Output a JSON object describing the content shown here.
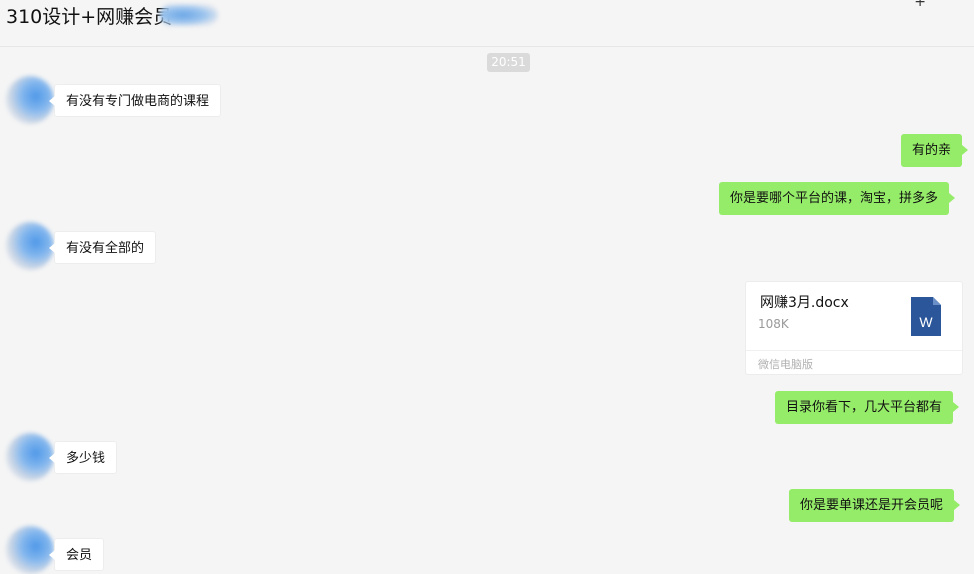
{
  "header": {
    "title": "310设计+网赚会员",
    "more_icon": "more-icon"
  },
  "time_divider": "20:51",
  "messages": [
    {
      "side": "left",
      "text": "有没有专门做电商的课程"
    },
    {
      "side": "right",
      "text": "有的亲"
    },
    {
      "side": "right",
      "text": "你是要哪个平台的课，淘宝，拼多多"
    },
    {
      "side": "left",
      "text": "有没有全部的"
    },
    {
      "side": "right",
      "type": "file",
      "file_name": "网赚3月.docx",
      "file_size": "108K",
      "file_source": "微信电脑版",
      "file_icon": "word-doc-icon",
      "file_icon_letter": "W"
    },
    {
      "side": "right",
      "text": "目录你看下，几大平台都有"
    },
    {
      "side": "left",
      "text": "多少钱"
    },
    {
      "side": "right",
      "text": "你是要单课还是开会员呢"
    },
    {
      "side": "left",
      "text": "会员"
    }
  ],
  "colors": {
    "background": "#f5f5f5",
    "sent_bubble": "#95ec69",
    "received_bubble": "#ffffff",
    "word_icon": "#2b579a",
    "time_badge": "#dadada"
  }
}
